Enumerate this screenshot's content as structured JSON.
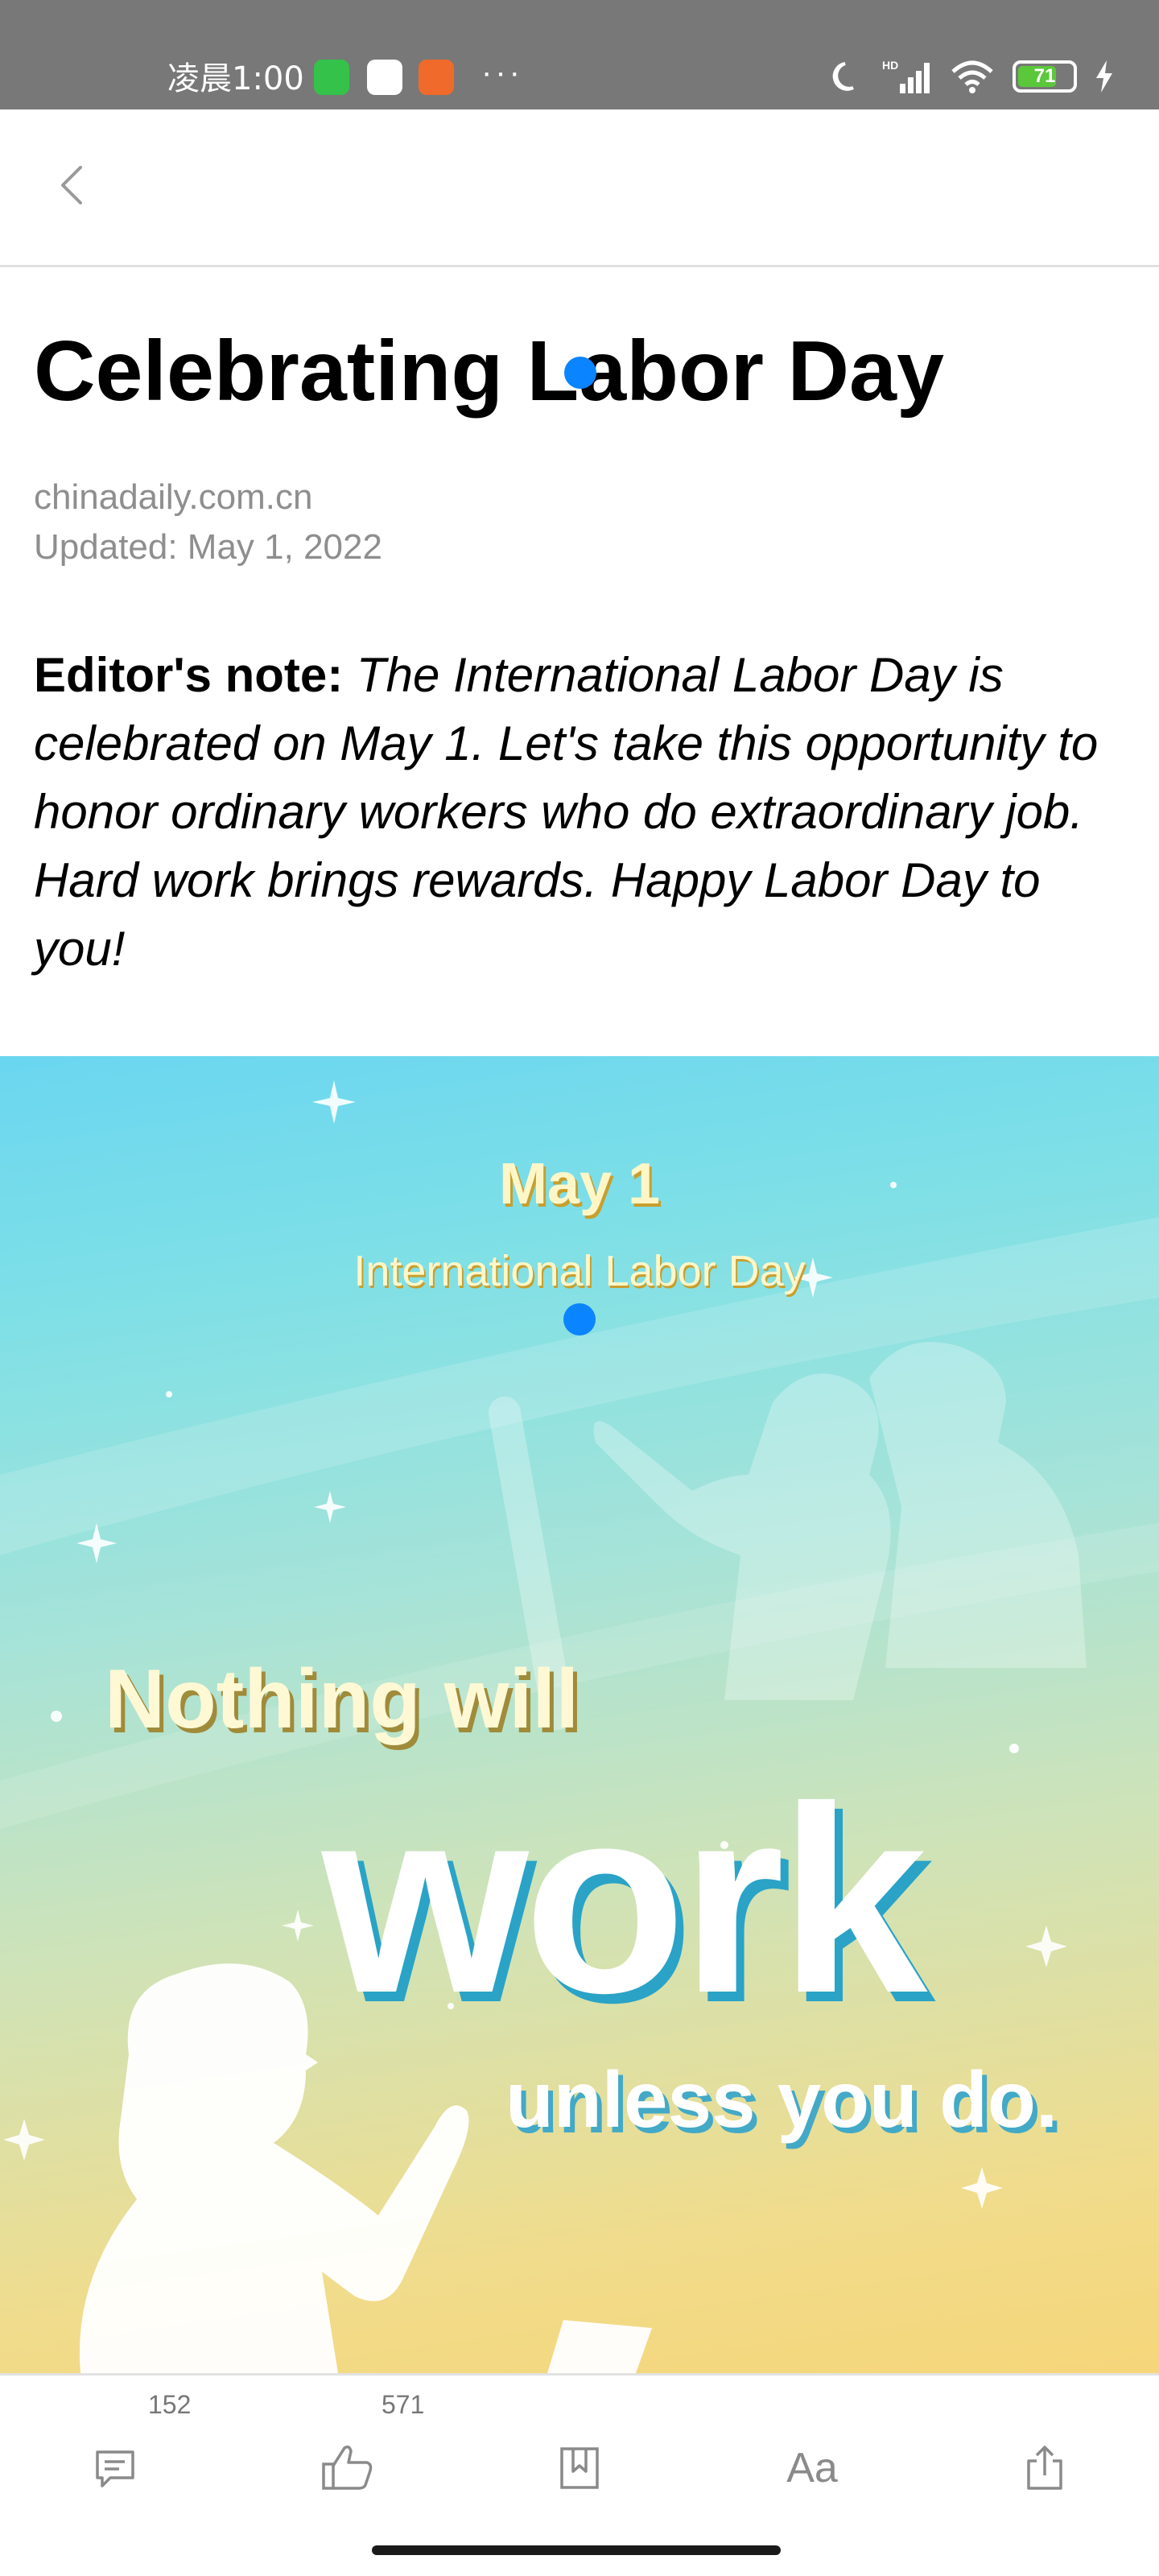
{
  "status_bar": {
    "time": "凌晨1:00",
    "more": "···",
    "battery": "71",
    "network": "HD"
  },
  "nav": {
    "back_icon": "chevron-left-icon"
  },
  "article": {
    "title": "Celebrating Labor Day",
    "source": "chinadaily.com.cn",
    "updated": "Updated: May 1, 2022",
    "note_label": "Editor's note:",
    "note_body": " The International Labor Day is celebrated on May 1. Let's take this opportunity to honor ordinary workers who do extraordinary job. Hard work brings rewards. Happy Labor Day to you!"
  },
  "hero": {
    "date": "May 1",
    "subtitle": "International Labor Day",
    "line1": "Nothing will",
    "line2": "work",
    "line3": "unless you do."
  },
  "toolbar": {
    "comment_count": "152",
    "like_count": "571",
    "font_label": "Aa",
    "icons": [
      "comment-icon",
      "thumbs-up-icon",
      "bookmark-icon",
      "font-size-icon",
      "share-icon"
    ]
  },
  "colors": {
    "status_bar": "#787878",
    "touch_dot": "#0a84ff",
    "battery_fill": "#5ac83a"
  }
}
